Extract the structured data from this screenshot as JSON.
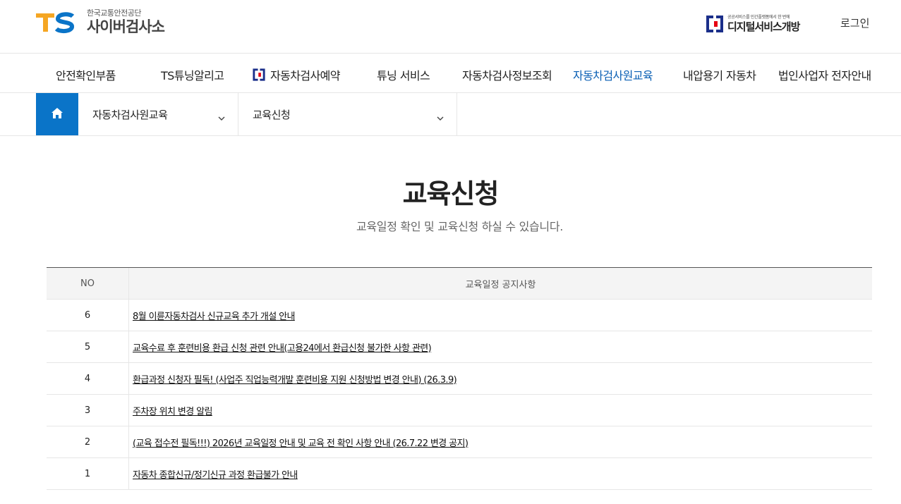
{
  "header": {
    "logo_mark": "TS",
    "logo_sub": "한국교통안전공단",
    "logo_main": "사이버검사소",
    "digital_sub": "공공서비스를 민간플랫폼에서 한 번에",
    "digital_main": "디지털서비스개방",
    "login_label": "로그인",
    "brand_colors": {
      "orange": "#f5a623",
      "blue": "#0a74c8",
      "red": "#e60012",
      "navy": "#1b2f8a"
    }
  },
  "nav": {
    "items": [
      {
        "label": "안전확인부품"
      },
      {
        "label": "TS튜닝알리고"
      },
      {
        "label": "자동차검사예약"
      },
      {
        "label": "튜닝 서비스"
      },
      {
        "label": "자동차검사정보조회"
      },
      {
        "label": "자동차검사원교육"
      },
      {
        "label": "내압용기 자동차"
      },
      {
        "label": "법인사업자 전자안내"
      }
    ],
    "active_index": 5,
    "active_color": "#0a5fb4"
  },
  "breadcrumb": {
    "home_icon": "home-icon",
    "level1": "자동차검사원교육",
    "level2": "교육신청"
  },
  "page": {
    "title": "교육신청",
    "description": "교육일정 확인 및 교육신청 하실 수 있습니다."
  },
  "board": {
    "headers": {
      "no": "NO",
      "title": "교육일정 공지사항"
    },
    "rows": [
      {
        "no": "6",
        "title": "8월 이륜자동차검사 신규교육 추가 개설 안내"
      },
      {
        "no": "5",
        "title": "교육수료 후 훈련비용 환급 신청 관련 안내(고용24에서 환급신청 불가한 사항 관련)"
      },
      {
        "no": "4",
        "title": "환급과정 신청자 필독! (사업주 직업능력개발 훈련비용 지원 신청방법 변경 안내) (26.3.9)"
      },
      {
        "no": "3",
        "title": "주차장 위치 변경 알림"
      },
      {
        "no": "2",
        "title": "(교육 접수전 필독!!!) 2026년 교육일정 안내 및 교육 전 확인 사항 안내 (26.7.22 변경 공지)"
      },
      {
        "no": "1",
        "title": "자동차 종합신규/정기신규 과정 환급불가 안내"
      }
    ]
  }
}
